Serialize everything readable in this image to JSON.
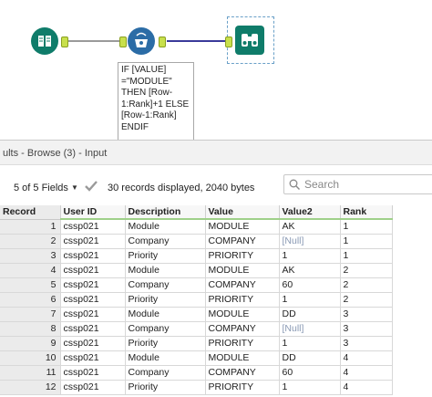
{
  "workflow": {
    "formula_text": "IF [VALUE]\n=\"MODULE\"\nTHEN [Row-\n1:Rank]+1 ELSE\n[Row-1:Rank]\nENDIF",
    "colors": {
      "input_tool": "#0f7c6a",
      "multirow_tool": "#2b6ca6",
      "browse_tool": "#0f7c6a",
      "connector": "#3a3a9a"
    }
  },
  "panel": {
    "title": "ults - Browse (3) - Input"
  },
  "toolbar": {
    "fields_label": "5 of 5 Fields",
    "records_info": "30 records displayed, 2040 bytes",
    "search_placeholder": "Search"
  },
  "table": {
    "columns": [
      "Record",
      "User ID",
      "Description",
      "Value",
      "Value2",
      "Rank"
    ],
    "rows": [
      [
        "1",
        "cssp021",
        "Module",
        "MODULE",
        "AK",
        "1"
      ],
      [
        "2",
        "cssp021",
        "Company",
        "COMPANY",
        "[Null]",
        "1"
      ],
      [
        "3",
        "cssp021",
        "Priority",
        "PRIORITY",
        "1",
        "1"
      ],
      [
        "4",
        "cssp021",
        "Module",
        "MODULE",
        "AK",
        "2"
      ],
      [
        "5",
        "cssp021",
        "Company",
        "COMPANY",
        "60",
        "2"
      ],
      [
        "6",
        "cssp021",
        "Priority",
        "PRIORITY",
        "1",
        "2"
      ],
      [
        "7",
        "cssp021",
        "Module",
        "MODULE",
        "DD",
        "3"
      ],
      [
        "8",
        "cssp021",
        "Company",
        "COMPANY",
        "[Null]",
        "3"
      ],
      [
        "9",
        "cssp021",
        "Priority",
        "PRIORITY",
        "1",
        "3"
      ],
      [
        "10",
        "cssp021",
        "Module",
        "MODULE",
        "DD",
        "4"
      ],
      [
        "11",
        "cssp021",
        "Company",
        "COMPANY",
        "60",
        "4"
      ],
      [
        "12",
        "cssp021",
        "Priority",
        "PRIORITY",
        "1",
        "4"
      ]
    ]
  }
}
